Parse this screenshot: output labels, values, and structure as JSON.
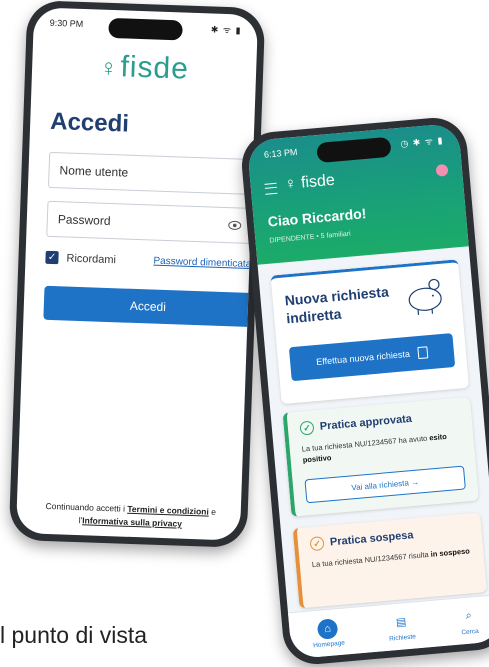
{
  "login": {
    "status_time": "9:30 PM",
    "status_icons": "✱ ᯤ ▮",
    "logo_text": "fisde",
    "heading": "Accedi",
    "username_placeholder": "Nome utente",
    "password_placeholder": "Password",
    "remember_label": "Ricordami",
    "forgot_link": "Password dimenticata?",
    "login_button": "Accedi",
    "terms_prefix": "Continuando accetti i",
    "terms_link": "Termini e condizioni",
    "terms_mid": "e l'",
    "privacy_link": "Informativa sulla privacy"
  },
  "home": {
    "status_time": "6:13 PM",
    "status_icons": "◷ ✱ ᯤ ▮",
    "logo_text": "fisde",
    "greeting": "Ciao Riccardo!",
    "meta": "DIPENDENTE • 5 familiari",
    "new_request": {
      "title": "Nuova richiesta indiretta",
      "button": "Effettua nuova richiesta"
    },
    "approved": {
      "title": "Pratica approvata",
      "desc": "La tua richiesta NU/1234567 ha avuto",
      "desc_bold": "esito positivo",
      "button": "Vai alla richiesta →"
    },
    "suspended": {
      "title": "Pratica sospesa",
      "desc": "La tua richiesta NU/1234567 risulta",
      "desc_bold": "in sospeso"
    },
    "nav": [
      {
        "label": "Homepage",
        "icon": "home-icon"
      },
      {
        "label": "Richieste",
        "icon": "document-icon"
      },
      {
        "label": "Cerca",
        "icon": "search-icon"
      }
    ]
  },
  "caption": "l punto di vista",
  "colors": {
    "primary": "#1e73c7",
    "navy": "#1f3f72",
    "green": "#2aa66a",
    "orange": "#e6913a",
    "teal": "#2a9d8f"
  }
}
